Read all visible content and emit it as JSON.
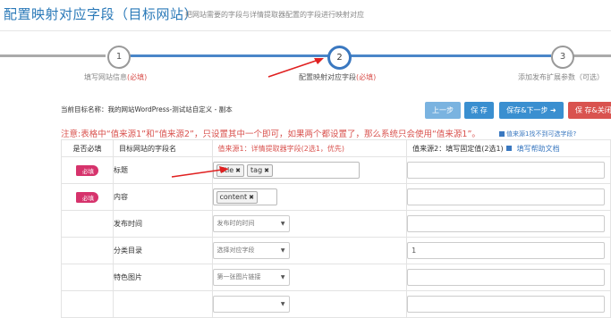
{
  "header": {
    "title": "配置映射对应字段（目标网站）",
    "subtitle": "把网站需要的字段与详情提取器配置的字段进行映射对应"
  },
  "steps": [
    {
      "number": "1",
      "label": "填写网站信息",
      "required": "(必填)"
    },
    {
      "number": "2",
      "label": "配置映射对应字段",
      "required": "(必填)"
    },
    {
      "number": "3",
      "label": "添加发布扩展参数（可选）",
      "required": ""
    }
  ],
  "site_info": "当前目标名称：我的网站WordPress-测试站自定义 - 副本",
  "buttons": {
    "prev": "上一步",
    "save": "保 存",
    "save_next": "保存&下一步 ➜",
    "save_close": "保 存&关闭"
  },
  "note": "注意:表格中“值来源1”和“值来源2”，只设置其中一个即可，如果两个都设置了，那么系统只会使用“值来源1”。",
  "help_link": "值来源1找不到可选字段?",
  "table": {
    "headers": {
      "must": "是否必填",
      "field": "目标网站的字段名",
      "src1": "值来源1：详情提取器字段(2选1，优先)",
      "src2": "值来源2：填写固定值(2选1)",
      "src2_link": "填写帮助文档"
    },
    "required_badge": "必填",
    "rows": [
      {
        "required": true,
        "field": "标题",
        "tags": [
          "title",
          "tag"
        ],
        "select": "",
        "fixed": ""
      },
      {
        "required": true,
        "field": "内容",
        "tags": [
          "content"
        ],
        "select": "",
        "fixed": ""
      },
      {
        "required": false,
        "field": "发布时间",
        "tags": [],
        "select": "发布时的时间",
        "fixed": ""
      },
      {
        "required": false,
        "field": "分类目录",
        "tags": [],
        "select": "选择对应字段",
        "fixed": "1"
      },
      {
        "required": false,
        "field": "特色图片",
        "tags": [],
        "select": "第一张图片链接",
        "fixed": ""
      }
    ]
  },
  "colors": {
    "accent": "#3a78c0",
    "danger": "#d9534f",
    "badge": "#d6336c"
  }
}
